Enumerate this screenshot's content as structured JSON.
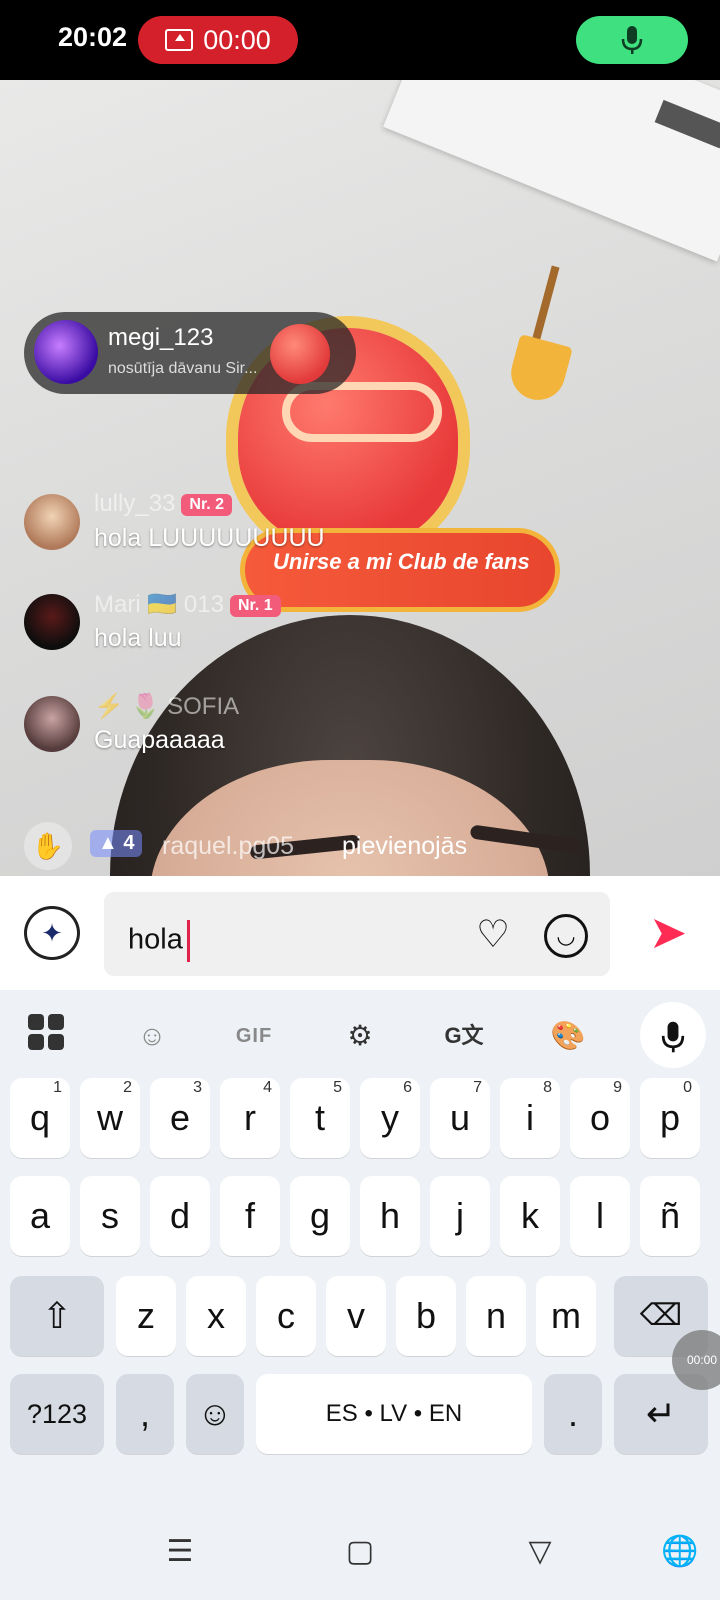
{
  "status_bar": {
    "time": "20:02",
    "recording_timer": "00:00"
  },
  "gift": {
    "username": "megi_123",
    "subtitle": "nosūtīja dāvanu Sir..."
  },
  "fan_club": {
    "label": "Unirse a mi Club de fans"
  },
  "comments": [
    {
      "username": "lully_33",
      "badge": "Nr. 2",
      "text": "hola LUUUUUUUUU"
    },
    {
      "username": "Mari 🇺🇦 013",
      "badge": "Nr. 1",
      "text": "hola luu"
    },
    {
      "username": "⚡ 🌷 SOFIA",
      "badge": "",
      "text": "Guapaaaaa"
    }
  ],
  "join": {
    "level": "4",
    "username": "raquel.pg05",
    "text": "pievienojās"
  },
  "chat": {
    "input_value": "hola"
  },
  "keyboard": {
    "toolbar": {
      "gif_label": "GIF"
    },
    "row1": [
      {
        "k": "q",
        "n": "1"
      },
      {
        "k": "w",
        "n": "2"
      },
      {
        "k": "e",
        "n": "3"
      },
      {
        "k": "r",
        "n": "4"
      },
      {
        "k": "t",
        "n": "5"
      },
      {
        "k": "y",
        "n": "6"
      },
      {
        "k": "u",
        "n": "7"
      },
      {
        "k": "i",
        "n": "8"
      },
      {
        "k": "o",
        "n": "9"
      },
      {
        "k": "p",
        "n": "0"
      }
    ],
    "row2": [
      "a",
      "s",
      "d",
      "f",
      "g",
      "h",
      "j",
      "k",
      "l",
      "ñ"
    ],
    "row3": [
      "z",
      "x",
      "c",
      "v",
      "b",
      "n",
      "m"
    ],
    "symbols_label": "?123",
    "comma": ",",
    "space_label": "ES • LV • EN",
    "period": ".",
    "floating_timer": "00:00"
  },
  "colors": {
    "record_red": "#d3202a",
    "mic_green": "#3ee07f",
    "send_pink": "#fe2c55",
    "badge_pink": "#f25c7a"
  }
}
